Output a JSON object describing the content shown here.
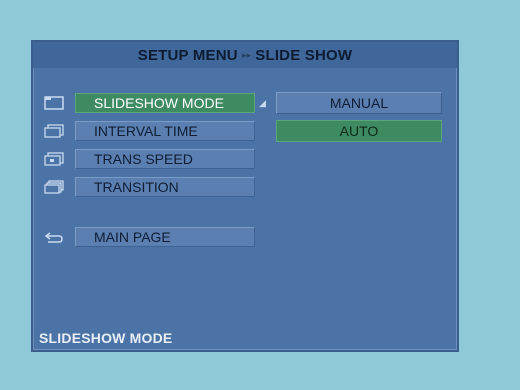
{
  "title": {
    "part1": "SETUP MENU",
    "separator": "▸▸",
    "part2": "SLIDE SHOW"
  },
  "menu": [
    {
      "label": "SLIDESHOW MODE",
      "icon": "slideshow-icon",
      "active": true
    },
    {
      "label": "INTERVAL TIME",
      "icon": "interval-icon",
      "active": false
    },
    {
      "label": "TRANS SPEED",
      "icon": "speed-icon",
      "active": false
    },
    {
      "label": "TRANSITION",
      "icon": "transition-icon",
      "active": false
    }
  ],
  "main_page": {
    "label": "MAIN PAGE",
    "icon": "return-icon"
  },
  "options": [
    {
      "label": "MANUAL",
      "selected": false
    },
    {
      "label": "AUTO",
      "selected": true
    }
  ],
  "status": "SLIDESHOW MODE",
  "colors": {
    "background": "#8fc9d8",
    "panel": "#4c73a6",
    "highlight": "#3e8b62",
    "item": "#5a7fb0"
  }
}
